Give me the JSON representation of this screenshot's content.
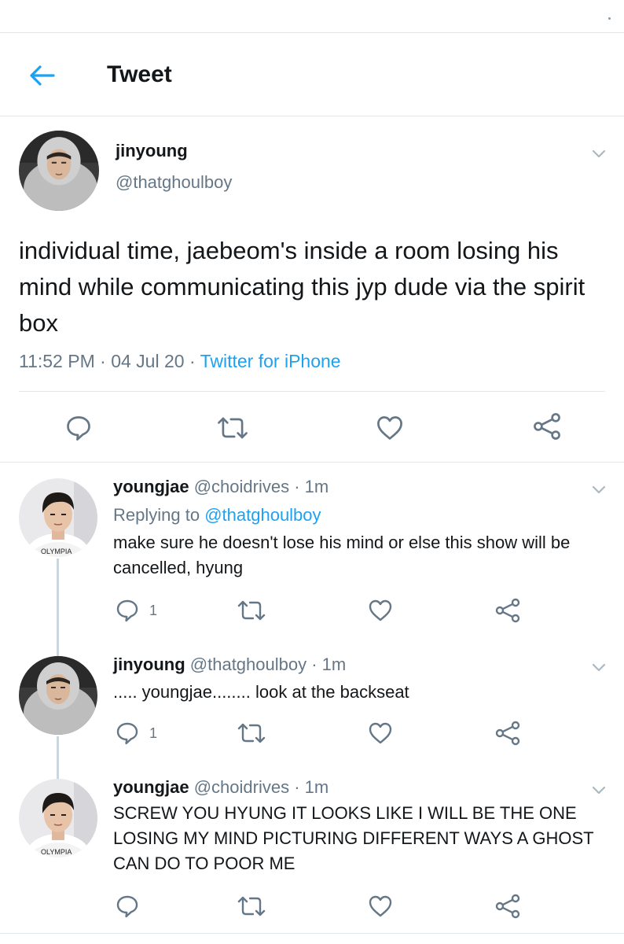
{
  "header": {
    "title": "Tweet"
  },
  "main_tweet": {
    "name": "jinyoung",
    "handle": "@thatghoulboy",
    "text": "individual time, jaebeom's inside a room losing his mind while communicating this jyp dude via the spirit box",
    "time": "11:52 PM",
    "date": "04 Jul 20",
    "separator": "·",
    "source": "Twitter for iPhone"
  },
  "replies": [
    {
      "name": "youngjae",
      "handle": "@choidrives",
      "age": "· 1m",
      "replying_prefix": "Replying to",
      "replying_to": "@thatghoulboy",
      "text": "make sure he doesn't lose his mind or else this show will be cancelled, hyung",
      "reply_count": "1"
    },
    {
      "name": "jinyoung",
      "handle": "@thatghoulboy",
      "age": "· 1m",
      "text": "..... youngjae........ look at the backseat",
      "reply_count": "1"
    },
    {
      "name": "youngjae",
      "handle": "@choidrives",
      "age": "· 1m",
      "text": "SCREW YOU HYUNG IT LOOKS LIKE I WILL BE THE ONE LOSING MY MIND PICTURING DIFFERENT WAYS A GHOST CAN DO TO POOR ME",
      "reply_count": ""
    }
  ],
  "colors": {
    "accent": "#1da1f2",
    "secondary_text": "#657786",
    "icon": "#657786",
    "divider": "#e1e8ed",
    "thread_line": "#ccd6dd"
  },
  "icons": {
    "back": "arrow-left-icon",
    "more": "chevron-down-icon",
    "reply": "speech-bubble-icon",
    "retweet": "retweet-icon",
    "like": "heart-icon",
    "share": "share-icon"
  }
}
